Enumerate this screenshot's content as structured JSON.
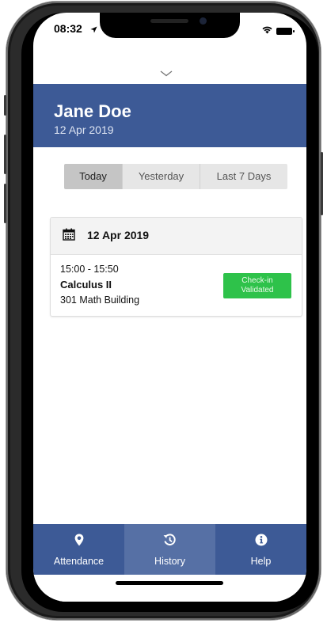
{
  "status_bar": {
    "time": "08:32",
    "icons": [
      "location-arrow-icon",
      "wifi-icon",
      "battery-icon"
    ]
  },
  "pull_indicator": {
    "icon": "chevron-down-icon"
  },
  "header": {
    "name": "Jane Doe",
    "date": "12 Apr 2019",
    "background": "#3d5a96"
  },
  "filter": {
    "options": [
      {
        "label": "Today",
        "selected": true
      },
      {
        "label": "Yesterday",
        "selected": false
      },
      {
        "label": "Last 7 Days",
        "selected": false
      }
    ]
  },
  "sessions": [
    {
      "date": "12 Apr 2019",
      "icon": "calendar-icon",
      "time": "15:00 - 15:50",
      "course": "Calculus II",
      "room": "301 Math Building",
      "status_line1": "Check-in",
      "status_line2": "Validated",
      "status_color": "#2ec24a"
    }
  ],
  "tabbar": {
    "items": [
      {
        "label": "Attendance",
        "icon": "map-marker-icon",
        "active": false
      },
      {
        "label": "History",
        "icon": "history-icon",
        "active": true
      },
      {
        "label": "Help",
        "icon": "info-circle-icon",
        "active": false
      }
    ]
  }
}
